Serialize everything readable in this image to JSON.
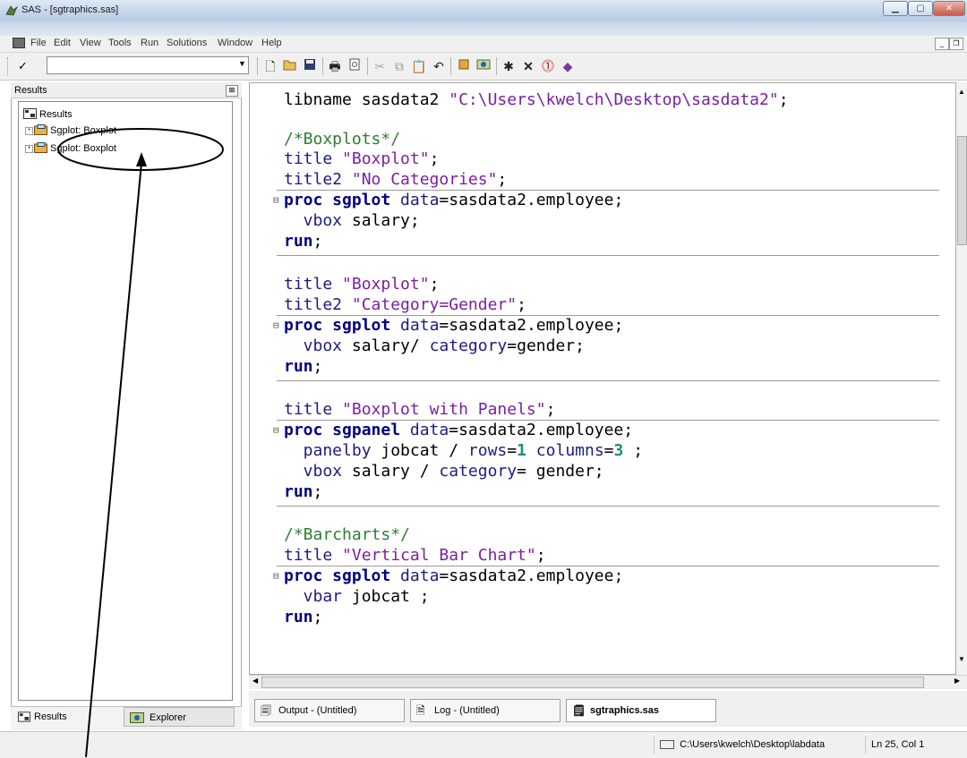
{
  "window": {
    "title": "SAS - [sgtraphics.sas]"
  },
  "menu": [
    "File",
    "Edit",
    "View",
    "Tools",
    "Run",
    "Solutions",
    "Window",
    "Help"
  ],
  "toolbar": {
    "command_check": "✓",
    "icons": [
      "new-icon",
      "open-icon",
      "save-icon",
      "print-icon",
      "print-preview-icon",
      "cut-icon",
      "copy-icon",
      "paste-icon",
      "undo-icon",
      "new-library-icon",
      "explorer-icon",
      "run-icon",
      "clear-icon",
      "break-icon",
      "help-icon"
    ]
  },
  "results": {
    "header": "Results",
    "root": "Results",
    "items": [
      "Sgplot: Boxplot",
      "Sgplot: Boxplot"
    ],
    "tabs": [
      "Results",
      "Explorer"
    ]
  },
  "editor": {
    "lines": [
      "libname sasdata2 \"C:\\Users\\kwelch\\Desktop\\sasdata2\";",
      "/*Boxplots*/",
      "title \"Boxplot\";",
      "title2 \"No Categories\";",
      "proc sgplot data=sasdata2.employee;",
      "vbox salary;",
      "run;",
      "title \"Boxplot\";",
      "title2 \"Category=Gender\";",
      "proc sgplot data=sasdata2.employee;",
      "vbox salary/ category=gender;",
      "run;",
      "title \"Boxplot with Panels\";",
      "proc sgpanel data=sasdata2.employee;",
      "panelby jobcat / rows=1 columns=3 ;",
      "vbox salary / category= gender;",
      "run;",
      "/*Barcharts*/",
      "title \"Vertical Bar Chart\";",
      "proc sgplot data=sasdata2.employee;",
      "vbar jobcat ;",
      "run;"
    ]
  },
  "window_tabs": [
    "Output - (Untitled)",
    "Log - (Untitled)",
    "sgtraphics.sas"
  ],
  "status": {
    "path": "C:\\Users\\kwelch\\Desktop\\labdata",
    "position": "Ln 25, Col 1"
  }
}
